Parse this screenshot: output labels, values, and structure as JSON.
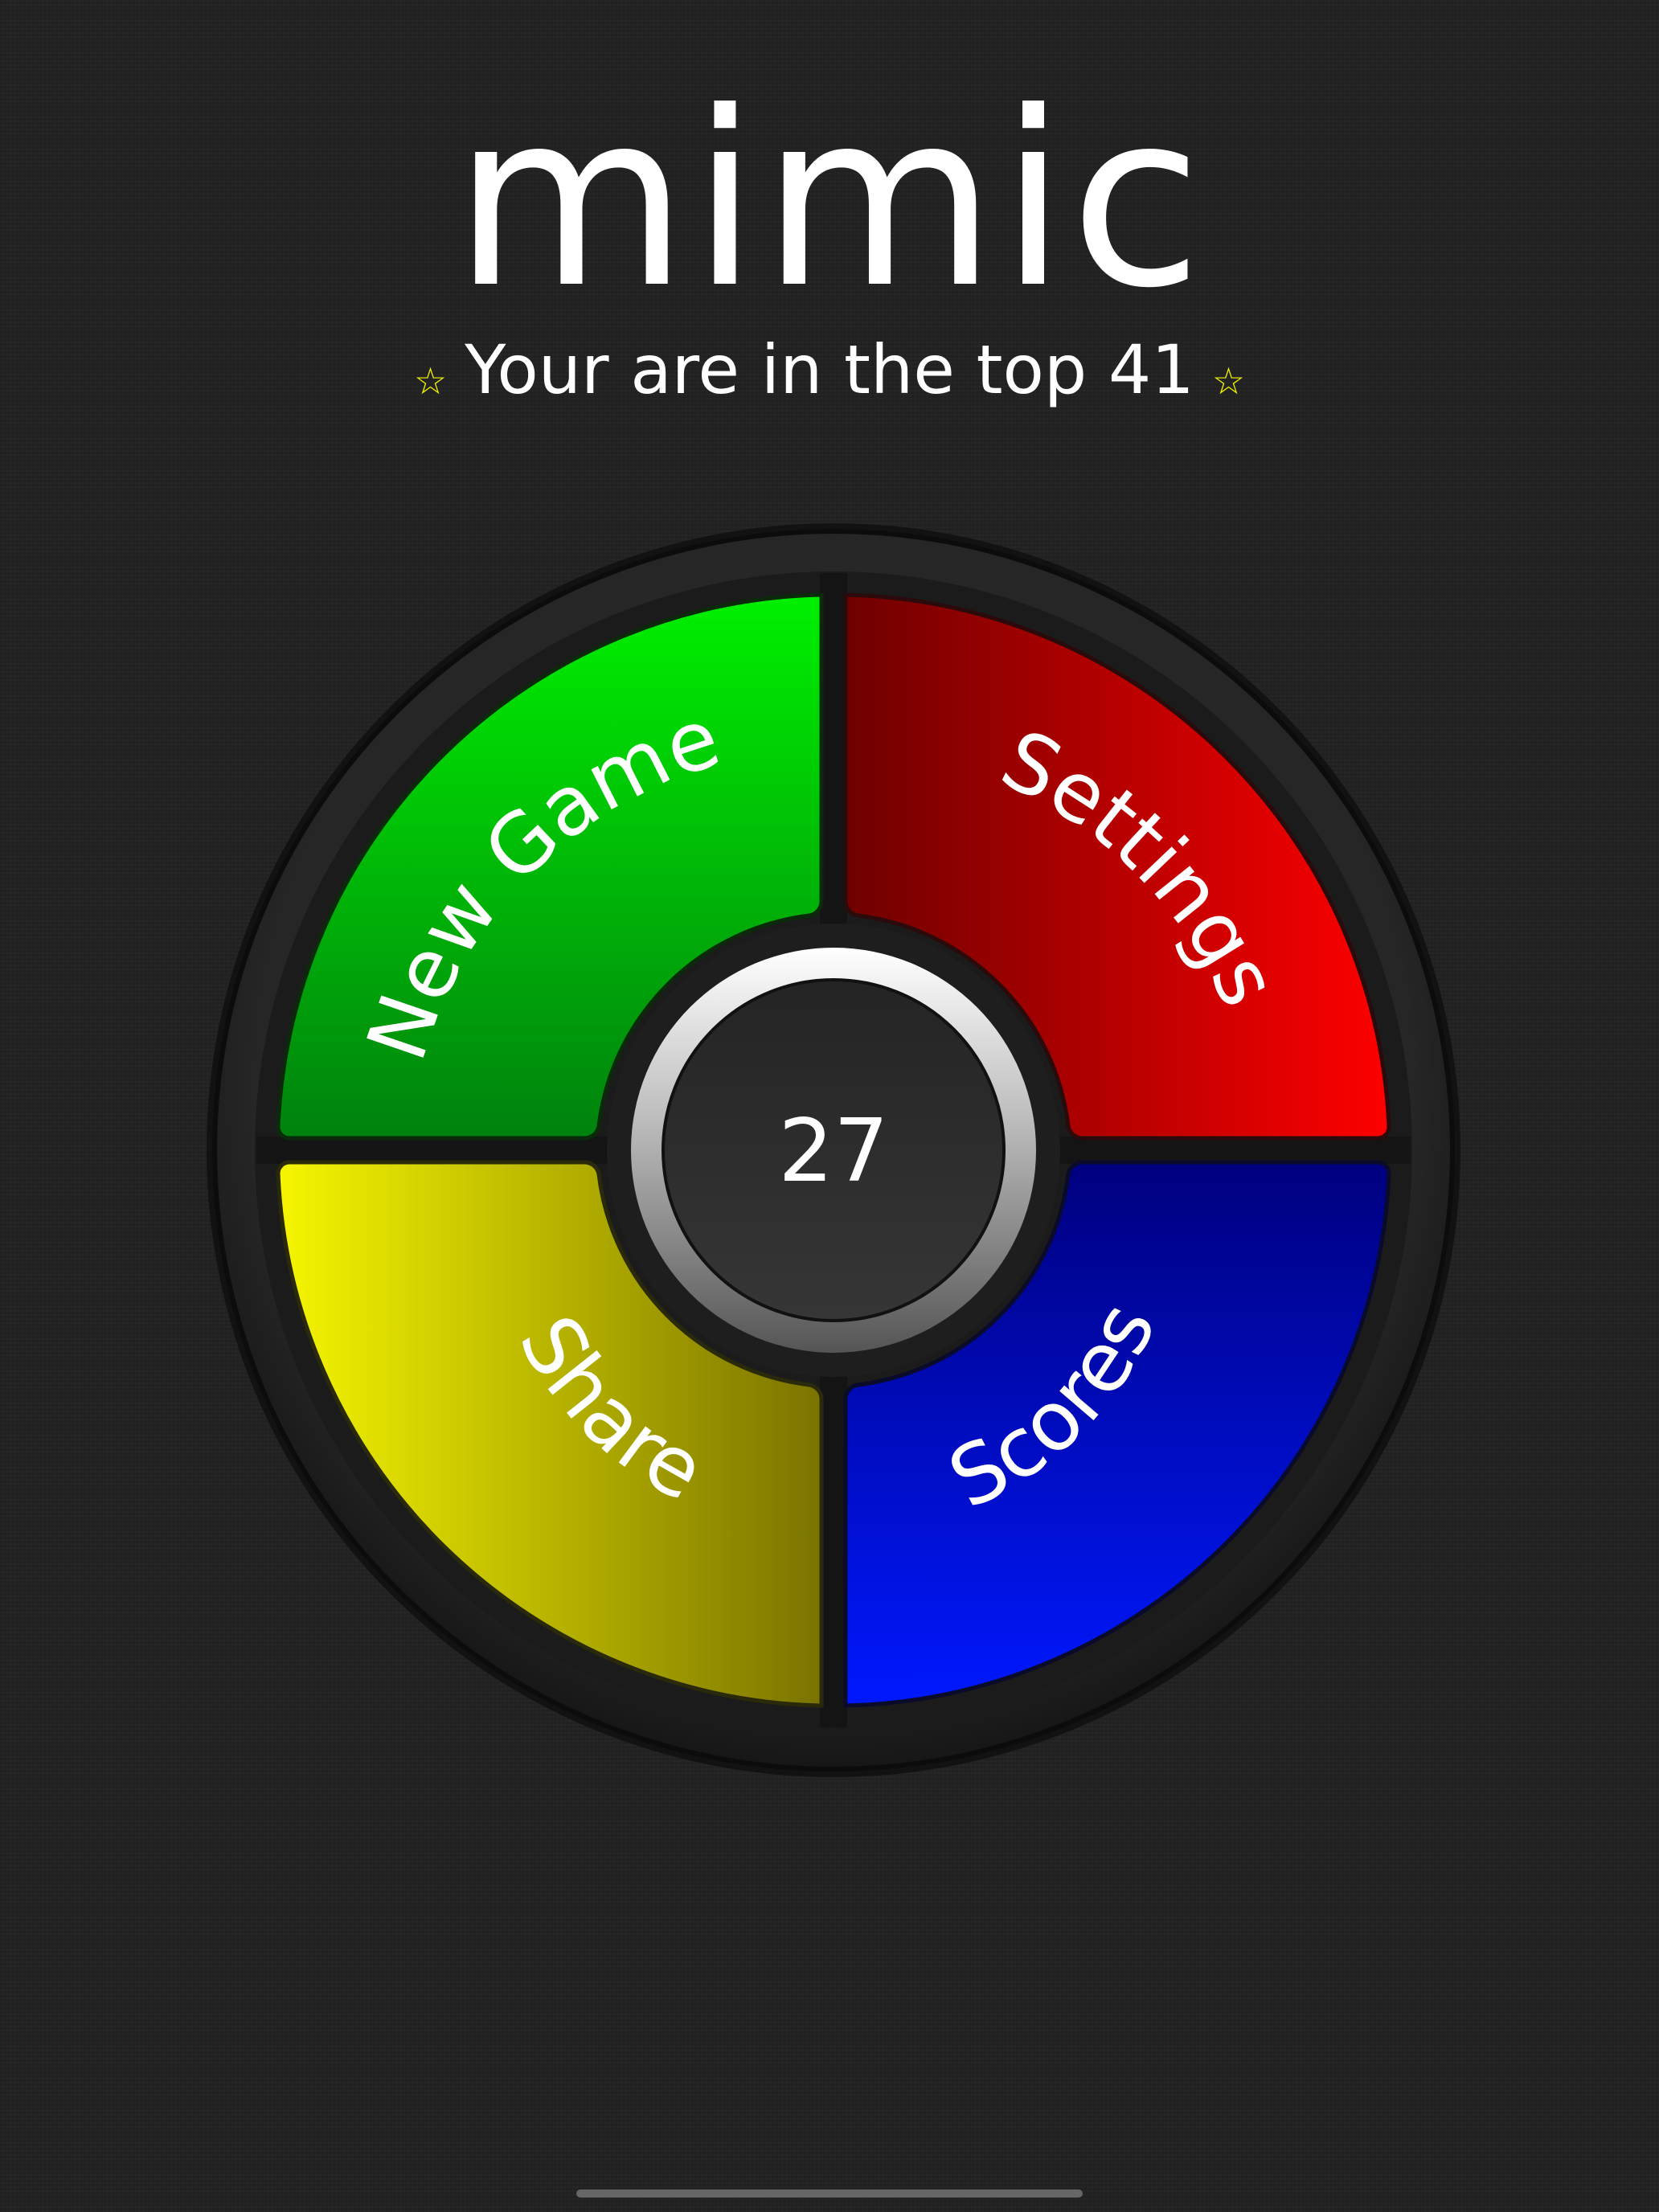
{
  "title": "mimic",
  "rank": {
    "text": "Your are in the top 41",
    "star_icon": "star-icon"
  },
  "board": {
    "score": "27",
    "pads": {
      "green": {
        "label": "New Game",
        "color": "#00c800",
        "icon": ""
      },
      "red": {
        "label": "Settings",
        "color": "#e00000"
      },
      "yellow": {
        "label": "Share",
        "color": "#e0e000"
      },
      "blue": {
        "label": "Scores",
        "color": "#0000e6"
      }
    }
  },
  "colors": {
    "background": "#222222",
    "rank_star": "#f2f200",
    "text": "#ffffff"
  }
}
